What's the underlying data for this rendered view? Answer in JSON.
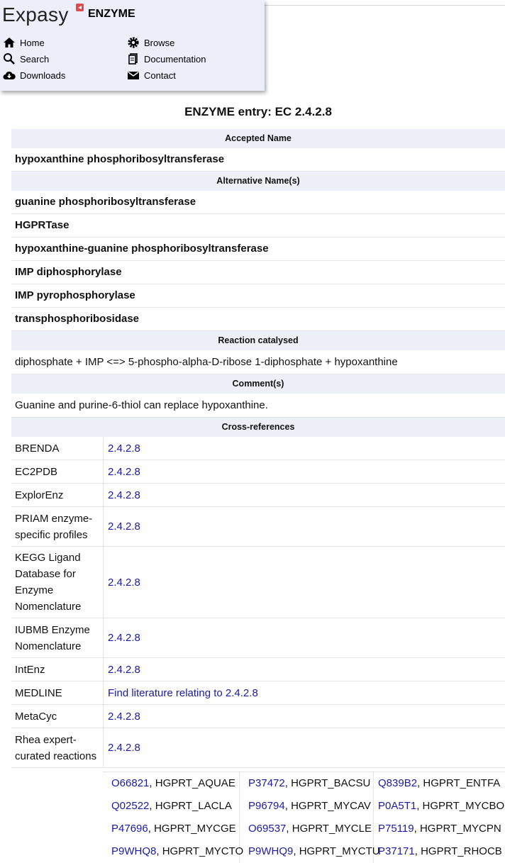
{
  "header": {
    "logo_text": "Expasy",
    "app_name": "ENZYME",
    "nav": [
      {
        "label": "Home",
        "icon": "home-icon"
      },
      {
        "label": "Browse",
        "icon": "gear-icon"
      },
      {
        "label": "Search",
        "icon": "search-icon"
      },
      {
        "label": "Documentation",
        "icon": "document-icon"
      },
      {
        "label": "Downloads",
        "icon": "cloud-download-icon"
      },
      {
        "label": "Contact",
        "icon": "mail-icon"
      }
    ]
  },
  "entry": {
    "title": "ENZYME entry: EC 2.4.2.8",
    "accepted_name_header": "Accepted Name",
    "accepted_name": "hypoxanthine phosphoribosyltransferase",
    "alt_names_header": "Alternative Name(s)",
    "alt_names": [
      "guanine phosphoribosyltransferase",
      "HGPRTase",
      "hypoxanthine-guanine phosphoribosyltransferase",
      "IMP diphosphorylase",
      "IMP pyrophosphorylase",
      "transphosphoribosidase"
    ],
    "reaction_header": "Reaction catalysed",
    "reaction": "diphosphate + IMP <=> 5-phospho-alpha-D-ribose 1-diphosphate + hypoxanthine",
    "comment_header": "Comment(s)",
    "comment": "Guanine and purine-6-thiol can replace hypoxanthine.",
    "xref_header": "Cross-references",
    "xrefs": [
      {
        "name": "BRENDA",
        "value": "2.4.2.8"
      },
      {
        "name": "EC2PDB",
        "value": "2.4.2.8"
      },
      {
        "name": "ExplorEnz",
        "value": "2.4.2.8"
      },
      {
        "name": "PRIAM enzyme-specific profiles",
        "value": "2.4.2.8"
      },
      {
        "name": "KEGG Ligand Database for Enzyme Nomenclature",
        "value": "2.4.2.8"
      },
      {
        "name": "IUBMB Enzyme Nomenclature",
        "value": "2.4.2.8"
      },
      {
        "name": "IntEnz",
        "value": "2.4.2.8"
      },
      {
        "name": "MEDLINE",
        "value": "Find literature relating to 2.4.2.8"
      },
      {
        "name": "MetaCyc",
        "value": "2.4.2.8"
      },
      {
        "name": "Rhea expert-curated reactions",
        "value": "2.4.2.8"
      }
    ],
    "uniprot": [
      [
        {
          "acc": "O66821",
          "id": "HGPRT_AQUAE"
        },
        {
          "acc": "P37472",
          "id": "HGPRT_BACSU"
        },
        {
          "acc": "Q839B2",
          "id": "HGPRT_ENTFA"
        }
      ],
      [
        {
          "acc": "Q02522",
          "id": "HGPRT_LACLA"
        },
        {
          "acc": "P96794",
          "id": "HGPRT_MYCAV"
        },
        {
          "acc": "P0A5T1",
          "id": "HGPRT_MYCBO"
        }
      ],
      [
        {
          "acc": "P47696",
          "id": "HGPRT_MYCGE"
        },
        {
          "acc": "O69537",
          "id": "HGPRT_MYCLE"
        },
        {
          "acc": "P75119",
          "id": "HGPRT_MYCPN"
        }
      ],
      [
        {
          "acc": "P9WHQ8",
          "id": "HGPRT_MYCTO"
        },
        {
          "acc": "P9WHQ9",
          "id": "HGPRT_MYCTU"
        },
        {
          "acc": "P37171",
          "id": "HGPRT_RHOCB"
        }
      ]
    ]
  }
}
